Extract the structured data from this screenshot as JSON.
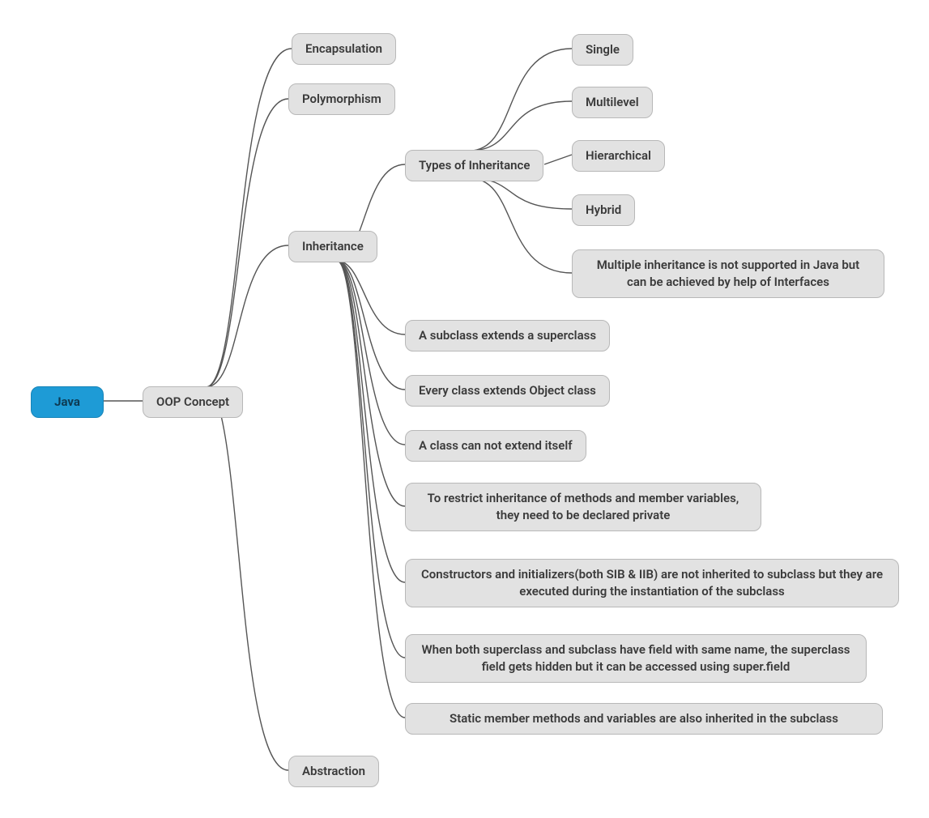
{
  "root": {
    "label": "Java"
  },
  "level1": {
    "label": "OOP Concept"
  },
  "oop_children": [
    {
      "label": "Encapsulation"
    },
    {
      "label": "Polymorphism"
    },
    {
      "label": "Inheritance"
    },
    {
      "label": "Abstraction"
    }
  ],
  "inheritance_children": [
    {
      "label": "Types of Inheritance"
    },
    {
      "label": "A subclass extends a superclass"
    },
    {
      "label": "Every class extends Object class"
    },
    {
      "label": "A class can not extend itself"
    },
    {
      "label": "To restrict inheritance of methods and member variables, they need to be declared private"
    },
    {
      "label": "Constructors and initializers(both SIB & IIB) are not inherited to subclass but they are executed during the instantiation of the subclass"
    },
    {
      "label": "When both superclass and subclass have field with same name, the superclass field gets hidden but it can be accessed using super.field"
    },
    {
      "label": "Static member methods and variables are also inherited in the subclass"
    }
  ],
  "types_children": [
    {
      "label": "Single"
    },
    {
      "label": "Multilevel"
    },
    {
      "label": "Hierarchical"
    },
    {
      "label": "Hybrid"
    },
    {
      "label": "Multiple inheritance is not supported in Java but can be achieved by help of Interfaces"
    }
  ]
}
